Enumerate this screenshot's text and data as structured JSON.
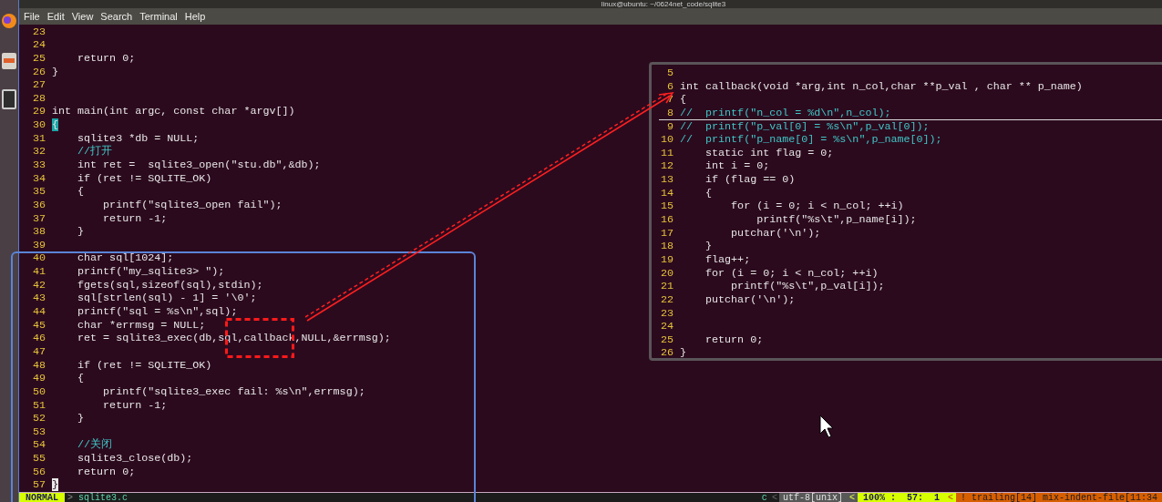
{
  "window": {
    "title": "linux@ubuntu: ~/0624net_code/sqlite3"
  },
  "menu": [
    "File",
    "Edit",
    "View",
    "Search",
    "Terminal",
    "Help"
  ],
  "editor": {
    "lines": [
      {
        "n": "23"
      },
      {
        "n": "24"
      },
      {
        "n": "25",
        "text": "    return 0;"
      },
      {
        "n": "26",
        "text": "}"
      },
      {
        "n": "27"
      },
      {
        "n": "28"
      },
      {
        "n": "29",
        "text": "int main(int argc, const char *argv[])"
      },
      {
        "n": "30",
        "text": "{",
        "match_brace": true
      },
      {
        "n": "31",
        "text": "    sqlite3 *db = NULL;"
      },
      {
        "n": "32",
        "text": "    //打开",
        "kind": "comment"
      },
      {
        "n": "33",
        "text": "    int ret =  sqlite3_open(\"stu.db\",&db);"
      },
      {
        "n": "34",
        "text": "    if (ret != SQLITE_OK)"
      },
      {
        "n": "35",
        "text": "    {"
      },
      {
        "n": "36",
        "text": "        printf(\"sqlite3_open fail\");"
      },
      {
        "n": "37",
        "text": "        return -1;"
      },
      {
        "n": "38",
        "text": "    }"
      },
      {
        "n": "39"
      },
      {
        "n": "40",
        "text": "    char sql[1024];"
      },
      {
        "n": "41",
        "text": "    printf(\"my_sqlite3> \");"
      },
      {
        "n": "42",
        "text": "    fgets(sql,sizeof(sql),stdin);"
      },
      {
        "n": "43",
        "text": "    sql[strlen(sql) - 1] = '\\0';"
      },
      {
        "n": "44",
        "text": "    printf(\"sql = %s\\n\",sql);"
      },
      {
        "n": "45",
        "text": "    char *errmsg = NULL;"
      },
      {
        "n": "46",
        "text": "    ret = sqlite3_exec(db,sql,callback,NULL,&errmsg);"
      },
      {
        "n": "47"
      },
      {
        "n": "48",
        "text": "    if (ret != SQLITE_OK)"
      },
      {
        "n": "49",
        "text": "    {"
      },
      {
        "n": "50",
        "text": "        printf(\"sqlite3_exec fail: %s\\n\",errmsg);"
      },
      {
        "n": "51",
        "text": "        return -1;"
      },
      {
        "n": "52",
        "text": "    }"
      },
      {
        "n": "53"
      },
      {
        "n": "54",
        "text": "    //关闭",
        "kind": "comment"
      },
      {
        "n": "55",
        "text": "    sqlite3_close(db);"
      },
      {
        "n": "56",
        "text": "    return 0;"
      },
      {
        "n": "57",
        "text": "}",
        "cursor": true
      }
    ]
  },
  "popup": {
    "lines": [
      {
        "n": "5"
      },
      {
        "n": "6",
        "text": "int callback(void *arg,int n_col,char **p_val , char ** p_name)"
      },
      {
        "n": "7",
        "text": "{"
      },
      {
        "n": "8",
        "text": "//  printf(\"n_col = %d\\n\",n_col);",
        "kind": "comment",
        "cursorline": true
      },
      {
        "n": "9",
        "text": "//  printf(\"p_val[0] = %s\\n\",p_val[0]);",
        "kind": "comment"
      },
      {
        "n": "10",
        "text": "//  printf(\"p_name[0] = %s\\n\",p_name[0]);",
        "kind": "comment"
      },
      {
        "n": "11",
        "text": "    static int flag = 0;"
      },
      {
        "n": "12",
        "text": "    int i = 0;"
      },
      {
        "n": "13",
        "text": "    if (flag == 0)"
      },
      {
        "n": "14",
        "text": "    {"
      },
      {
        "n": "15",
        "text": "        for (i = 0; i < n_col; ++i)"
      },
      {
        "n": "16",
        "text": "            printf(\"%s\\t\",p_name[i]);"
      },
      {
        "n": "17",
        "text": "        putchar('\\n');"
      },
      {
        "n": "18",
        "text": "    }"
      },
      {
        "n": "19",
        "text": "    flag++;"
      },
      {
        "n": "20",
        "text": "    for (i = 0; i < n_col; ++i)"
      },
      {
        "n": "21",
        "text": "        printf(\"%s\\t\",p_val[i]);"
      },
      {
        "n": "22",
        "text": "    putchar('\\n');"
      },
      {
        "n": "23"
      },
      {
        "n": "24"
      },
      {
        "n": "25",
        "text": "    return 0;"
      },
      {
        "n": "26",
        "text": "}"
      }
    ]
  },
  "status_bar": {
    "mode": "NORMAL",
    "separator": ">",
    "file": "sqlite3.c",
    "filetype": "c",
    "sep_1": "<",
    "encoding": "utf-8[unix]",
    "sep_2": "<",
    "position": "100% :  57:  1",
    "sep_3": "<",
    "warnings": "! trailing[14] mix-indent-file[11:34"
  }
}
